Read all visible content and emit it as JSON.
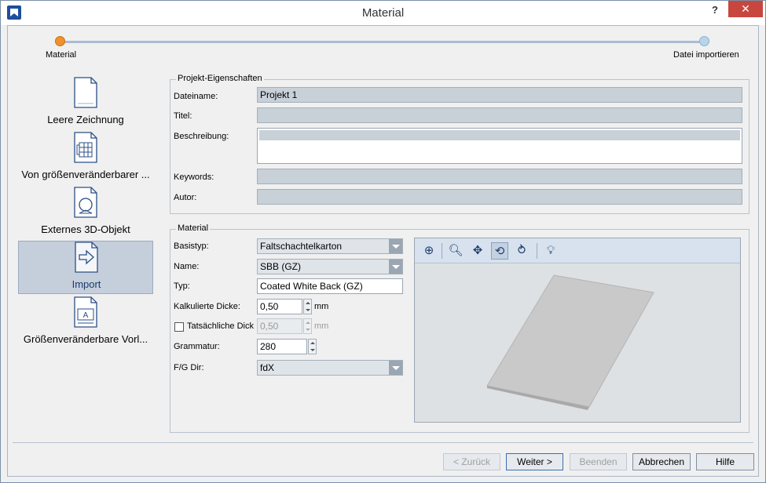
{
  "window": {
    "title": "Material",
    "help": "?",
    "close": "✕"
  },
  "steps": [
    {
      "label": "Material",
      "state": "active"
    },
    {
      "label": "Datei importieren",
      "state": "inactive"
    }
  ],
  "nav": [
    {
      "label": "Leere Zeichnung",
      "icon": "blank-document-icon"
    },
    {
      "label": "Von größenveränderbarer ...",
      "icon": "resizable-box-icon"
    },
    {
      "label": "Externes 3D-Objekt",
      "icon": "search-document-icon"
    },
    {
      "label": "Import",
      "icon": "import-arrow-icon",
      "selected": true
    },
    {
      "label": "Größenveränderbare Vorl...",
      "icon": "resizable-template-icon"
    }
  ],
  "project": {
    "group_title": "Projekt-Eigenschaften",
    "filename_label": "Dateiname:",
    "filename_value": "Projekt 1",
    "title_label": "Titel:",
    "title_value": "",
    "description_label": "Beschreibung:",
    "description_value": "",
    "keywords_label": "Keywords:",
    "keywords_value": "",
    "author_label": "Autor:",
    "author_value": ""
  },
  "material": {
    "group_title": "Material",
    "basistyp_label": "Basistyp:",
    "basistyp_value": "Faltschachtelkarton",
    "name_label": "Name:",
    "name_value": "SBB (GZ)",
    "typ_label": "Typ:",
    "typ_value": "Coated White Back (GZ)",
    "calc_thickness_label": "Kalkulierte Dicke:",
    "calc_thickness_value": "0,50",
    "calc_thickness_unit": "mm",
    "actual_thickness_label": "Tatsächliche Dick",
    "actual_thickness_value": "0,50",
    "actual_thickness_unit": "mm",
    "actual_thickness_checked": false,
    "grammage_label": "Grammatur:",
    "grammage_value": "280",
    "fg_dir_label": "F/G Dir:",
    "fg_dir_value": "fdX"
  },
  "preview_toolbar": [
    {
      "icon": "zoom-fit-icon",
      "glyph": "⊕"
    },
    {
      "icon": "zoom-icon",
      "glyph": "🔍︎"
    },
    {
      "icon": "pan-icon",
      "glyph": "✥"
    },
    {
      "icon": "rotate-3d-icon",
      "glyph": "⟲",
      "active": true
    },
    {
      "icon": "rotate-axis-icon",
      "glyph": "⥁"
    },
    {
      "icon": "light-bulb-icon",
      "glyph": "💡︎"
    }
  ],
  "buttons": {
    "back": "< Zurück",
    "next": "Weiter >",
    "finish": "Beenden",
    "cancel": "Abbrechen",
    "help": "Hilfe"
  },
  "colors": {
    "active_step": "#f0922b",
    "inactive_step": "#b7d4ea",
    "close_button": "#c7473e",
    "selected_nav": "#c5cfdb"
  }
}
